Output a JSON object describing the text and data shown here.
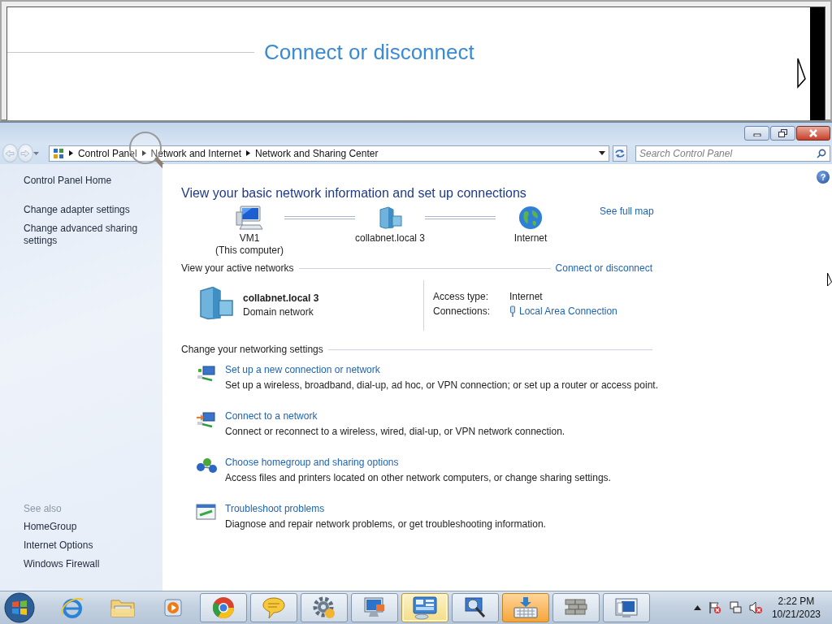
{
  "magnifier": {
    "link": "Connect or disconnect"
  },
  "navigation": {
    "back": {
      "disabled": true
    },
    "forward": {
      "disabled": true
    }
  },
  "address_bar": {
    "breadcrumbs": [
      "Control Panel",
      "Network and Internet",
      "Network and Sharing Center"
    ]
  },
  "search": {
    "placeholder": "Search Control Panel"
  },
  "help": "?",
  "sidebar": {
    "home": "Control Panel Home",
    "tasks": [
      "Change adapter settings",
      "Change advanced sharing settings"
    ],
    "see_also_heading": "See also",
    "see_also": [
      "HomeGroup",
      "Internet Options",
      "Windows Firewall"
    ]
  },
  "heading": "View your basic network information and set up connections",
  "network_map": {
    "nodes": [
      {
        "kind": "computer",
        "name": "VM1",
        "subtitle": "(This computer)"
      },
      {
        "kind": "domain",
        "name": "collabnet.local  3"
      },
      {
        "kind": "internet",
        "name": "Internet"
      }
    ],
    "see_full_map": "See full map"
  },
  "active_networks": {
    "heading": "View your active networks",
    "action": "Connect or disconnect",
    "network": {
      "name": "collabnet.local  3",
      "type": "Domain network"
    },
    "access_type_label": "Access type:",
    "access_type": "Internet",
    "connections_label": "Connections:",
    "connection": "Local Area Connection"
  },
  "settings": {
    "heading": "Change your networking settings",
    "tasks": [
      {
        "kind": "new-connection",
        "title": "Set up a new connection or network",
        "description": "Set up a wireless, broadband, dial-up, ad hoc, or VPN connection; or set up a router or access point."
      },
      {
        "kind": "connect",
        "title": "Connect to a network",
        "description": "Connect or reconnect to a wireless, wired, dial-up, or VPN network connection."
      },
      {
        "kind": "homegroup",
        "title": "Choose homegroup and sharing options",
        "description": "Access files and printers located on other network computers, or change sharing settings."
      },
      {
        "kind": "troubleshoot",
        "title": "Troubleshoot problems",
        "description": "Diagnose and repair network problems, or get troubleshooting information."
      }
    ]
  },
  "taskbar": {
    "apps": [
      {
        "kind": "ie",
        "running": false,
        "selected": false,
        "attention": false
      },
      {
        "kind": "explorer",
        "running": false,
        "selected": false,
        "attention": false
      },
      {
        "kind": "media",
        "running": false,
        "selected": false,
        "attention": false
      },
      {
        "kind": "chrome",
        "running": true,
        "selected": false,
        "attention": false
      },
      {
        "kind": "chat",
        "running": true,
        "selected": false,
        "attention": false
      },
      {
        "kind": "gear",
        "running": true,
        "selected": false,
        "attention": false
      },
      {
        "kind": "monitor",
        "running": true,
        "selected": false,
        "attention": false
      },
      {
        "kind": "control-panel",
        "running": true,
        "selected": true,
        "attention": false
      },
      {
        "kind": "magnifier",
        "running": true,
        "selected": false,
        "attention": false
      },
      {
        "kind": "keyboard",
        "running": true,
        "selected": false,
        "attention": true
      },
      {
        "kind": "firewall",
        "running": true,
        "selected": false,
        "attention": false
      },
      {
        "kind": "display",
        "running": true,
        "selected": false,
        "attention": false
      }
    ],
    "clock": {
      "time": "2:22 PM",
      "date": "10/21/2023"
    }
  }
}
